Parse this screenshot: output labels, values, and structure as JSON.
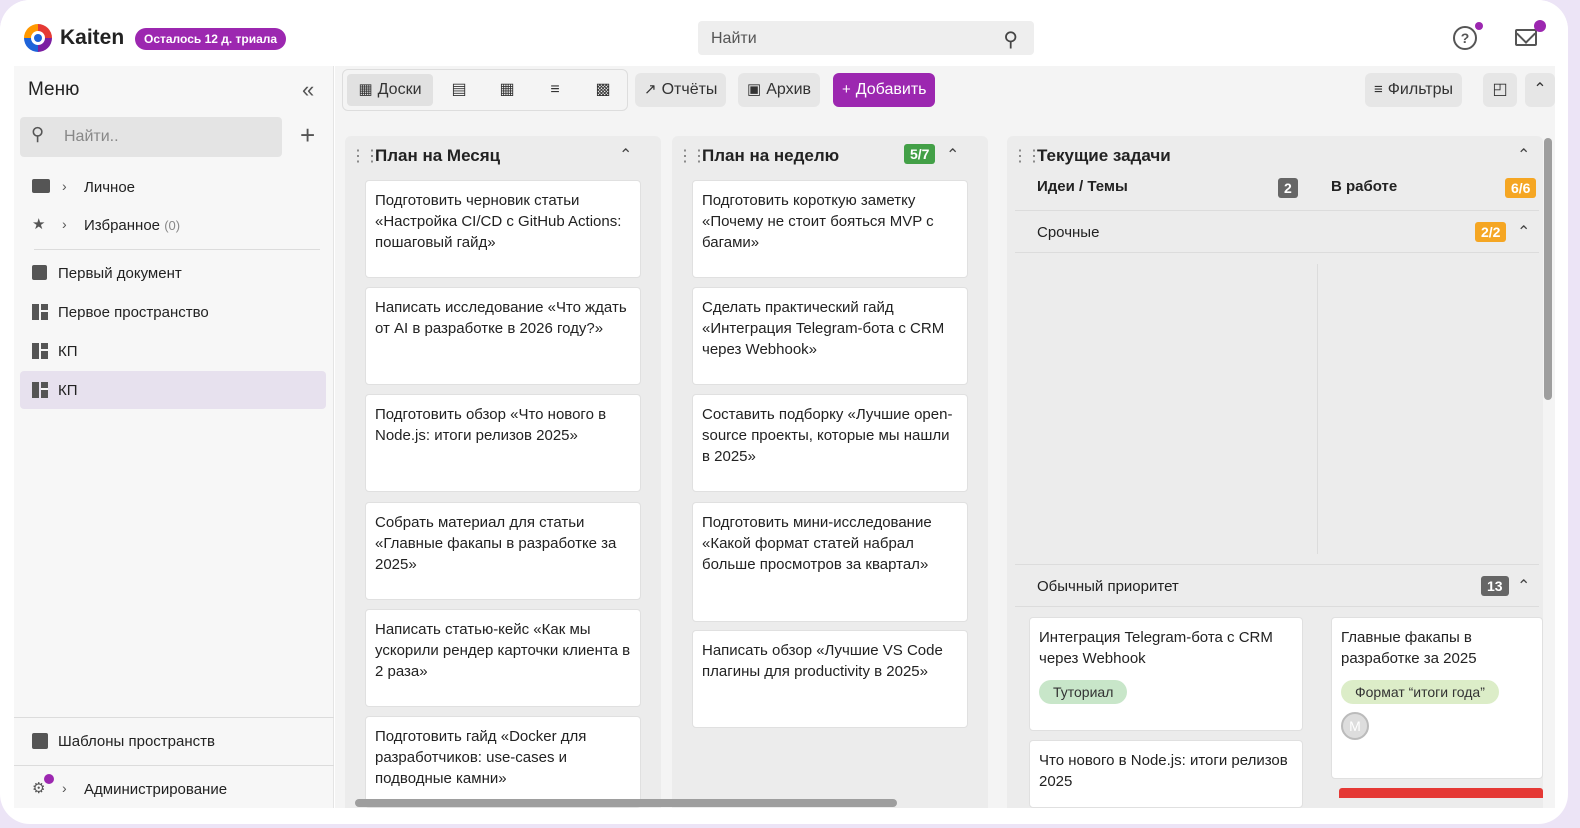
{
  "header": {
    "brand": "Kaiten",
    "trial_badge": "Осталось 12 д. триала",
    "search_placeholder": "Найти"
  },
  "sidebar": {
    "title": "Меню",
    "search_placeholder": "Найти..",
    "items": [
      {
        "label": "Личное"
      },
      {
        "label": "Избранное",
        "count": "(0)"
      },
      {
        "label": "Первый документ"
      },
      {
        "label": "Первое пространство"
      },
      {
        "label": "КП"
      },
      {
        "label": "КП"
      }
    ],
    "templates": "Шаблоны пространств",
    "admin": "Администрирование"
  },
  "toolbar": {
    "boards": "Доски",
    "reports": "Отчёты",
    "archive": "Архив",
    "add": "Добавить",
    "filters": "Фильтры"
  },
  "columns": [
    {
      "title": "План на Месяц",
      "cards": [
        "Подготовить черновик статьи «Настройка CI/CD с GitHub Actions: пошаговый гайд»",
        "Написать исследование «Что ждать от AI в разработке в 2026 году?»",
        "Подготовить обзор «Что нового в Node.js: итоги релизов 2025»",
        "Собрать материал для статьи «Главные факапы в разработке за 2025»",
        "Написать статью-кейс «Как мы ускорили рендер карточки клиента в 2 раза»",
        "Подготовить гайд «Docker для разработчиков: use-cases и подводные камни»"
      ]
    },
    {
      "title": "План на неделю",
      "badge": "5/7",
      "cards": [
        "Подготовить короткую заметку «Почему не стоит бояться MVP с багами»",
        "Сделать практический гайд «Интеграция Telegram-бота с CRM через Webhook»",
        "Составить подборку «Лучшие open-source проекты, которые мы нашли в 2025»",
        "Подготовить мини-исследование «Какой формат статей набрал больше просмотров за квартал»",
        "Написать обзор «Лучшие VS Code плагины для productivity в 2025»"
      ]
    },
    {
      "title": "Текущие задачи",
      "subcolumns": [
        {
          "title": "Идеи / Темы",
          "badge": "2"
        },
        {
          "title": "В работе",
          "badge": "6/6"
        }
      ],
      "lanes": [
        {
          "title": "Срочные",
          "badge": "2/2"
        },
        {
          "title": "Обычный приоритет",
          "badge": "13"
        }
      ],
      "cards": [
        {
          "text": "Интеграция Telegram-бота с CRM через Webhook",
          "tag": "Туториал"
        },
        {
          "text": "Главные факапы в разработке за 2025",
          "tag": "Формат “итоги года”",
          "avatar": "М"
        },
        {
          "text": "Что нового в Node.js: итоги релизов 2025"
        }
      ]
    }
  ],
  "colors": {
    "accent": "#9c27b0",
    "badge_green": "#43a047",
    "badge_orange": "#f5a623"
  }
}
